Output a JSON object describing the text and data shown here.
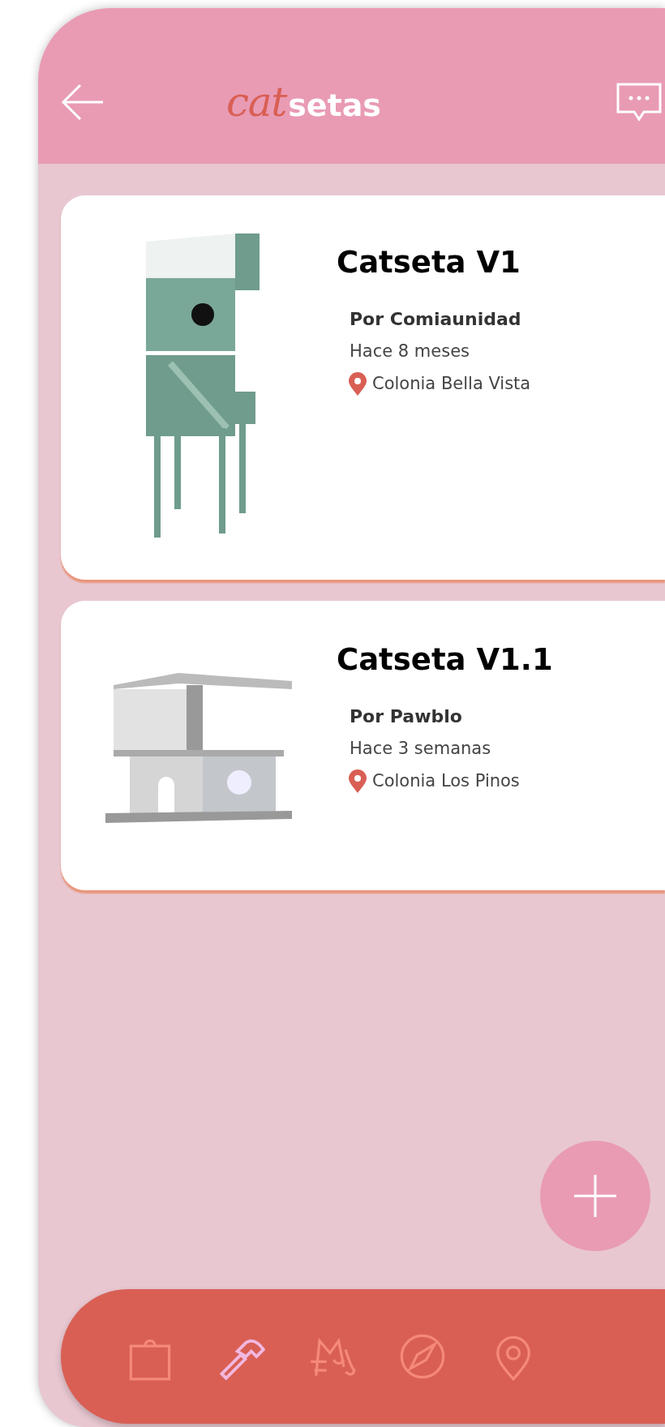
{
  "header": {
    "logo": {
      "part_1": "cat",
      "part_2": "setas"
    }
  },
  "cards": [
    {
      "title": "Catseta V1",
      "author": "Por Comiaunidad",
      "time": "Hace 8 meses",
      "location": "Colonia Bella Vista",
      "kind": "tower"
    },
    {
      "title": "Catseta V1.1",
      "author": "Por Pawblo",
      "time": "Hace 3 semanas",
      "location": "Colonia Los Pinos",
      "kind": "box"
    }
  ],
  "bottom_nav": [
    {
      "kind": "bag",
      "selected": false
    },
    {
      "kind": "hammer",
      "selected": true
    },
    {
      "kind": "cats",
      "selected": false
    },
    {
      "kind": "compass",
      "selected": false
    },
    {
      "kind": "pin",
      "selected": false
    }
  ]
}
